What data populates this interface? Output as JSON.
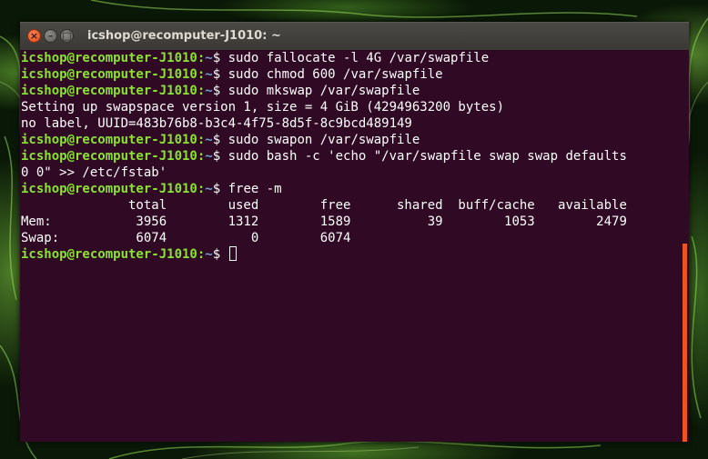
{
  "window": {
    "title": "icshop@recomputer-J1010: ~",
    "buttons": {
      "close": "×",
      "minimize": "–",
      "maximize": "□"
    }
  },
  "terminal": {
    "user": "icshop@recomputer-J1010",
    "sep": ":",
    "path": "~",
    "dollar": "$ ",
    "lines": [
      {
        "type": "prompt",
        "cmd": "sudo fallocate -l 4G /var/swapfile"
      },
      {
        "type": "prompt",
        "cmd": "sudo chmod 600 /var/swapfile"
      },
      {
        "type": "prompt",
        "cmd": "sudo mkswap /var/swapfile"
      },
      {
        "type": "output",
        "text": "Setting up swapspace version 1, size = 4 GiB (4294963200 bytes)"
      },
      {
        "type": "output",
        "text": "no label, UUID=483b76b8-b3c4-4f75-8d5f-8c9bcd489149"
      },
      {
        "type": "prompt",
        "cmd": "sudo swapon /var/swapfile"
      },
      {
        "type": "prompt",
        "cmd": "sudo bash -c 'echo \"/var/swapfile swap swap defaults"
      },
      {
        "type": "output",
        "text": "0 0\" >> /etc/fstab'"
      },
      {
        "type": "prompt",
        "cmd": "free -m"
      },
      {
        "type": "output",
        "text": "              total        used        free      shared  buff/cache   available"
      },
      {
        "type": "output",
        "text": "Mem:           3956        1312        1589          39        1053        2479"
      },
      {
        "type": "output",
        "text": "Swap:          6074           0        6074"
      },
      {
        "type": "prompt",
        "cmd": "",
        "cursor": true
      }
    ]
  },
  "colors": {
    "terminal_bg": "#300a24",
    "prompt_user": "#8ae234",
    "prompt_path": "#729fcf",
    "scrollbar": "#e95420"
  }
}
